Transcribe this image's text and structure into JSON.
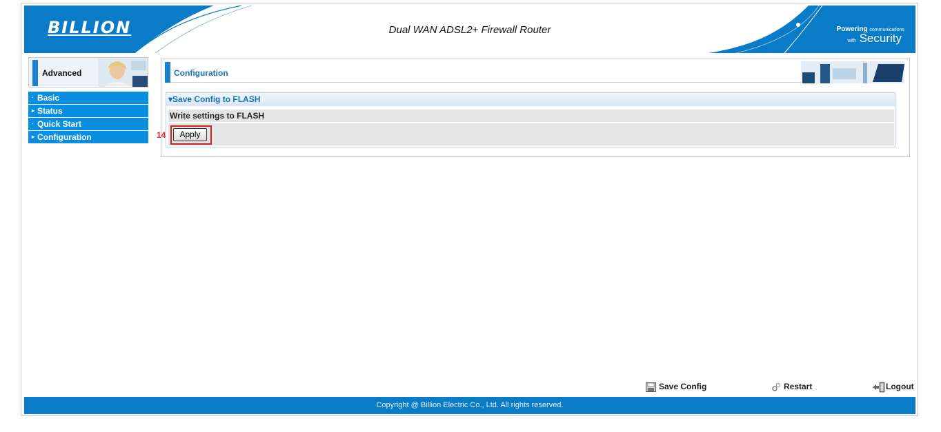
{
  "header": {
    "brand": "BILLION",
    "title": "Dual WAN ADSL2+ Firewall Router",
    "tagline_word": "Powering",
    "tagline_small": "communications",
    "tagline_with": "with",
    "tagline_big": "Security"
  },
  "sidebar": {
    "section_label": "Advanced",
    "items": [
      {
        "bullet": "·",
        "label": "Basic"
      },
      {
        "bullet": "▸",
        "label": "Status"
      },
      {
        "bullet": "·",
        "label": "Quick Start"
      },
      {
        "bullet": "▸",
        "label": "Configuration"
      }
    ]
  },
  "content": {
    "title": "Configuration",
    "panel_title": "▾Save Config to FLASH",
    "write_label": "Write settings to FLASH",
    "apply_label": "Apply",
    "annotation_number": "14"
  },
  "bottom_bar": {
    "save_config": "Save Config",
    "restart": "Restart",
    "logout": "Logout"
  },
  "footer": {
    "copyright": "Copyright @ Billion Electric Co., Ltd. All rights reserved."
  },
  "colors": {
    "brand_blue": "#0a7cc7",
    "menu_blue": "#0a8ee0",
    "title_blue": "#1b6fb3",
    "highlight_red": "#d02020"
  }
}
